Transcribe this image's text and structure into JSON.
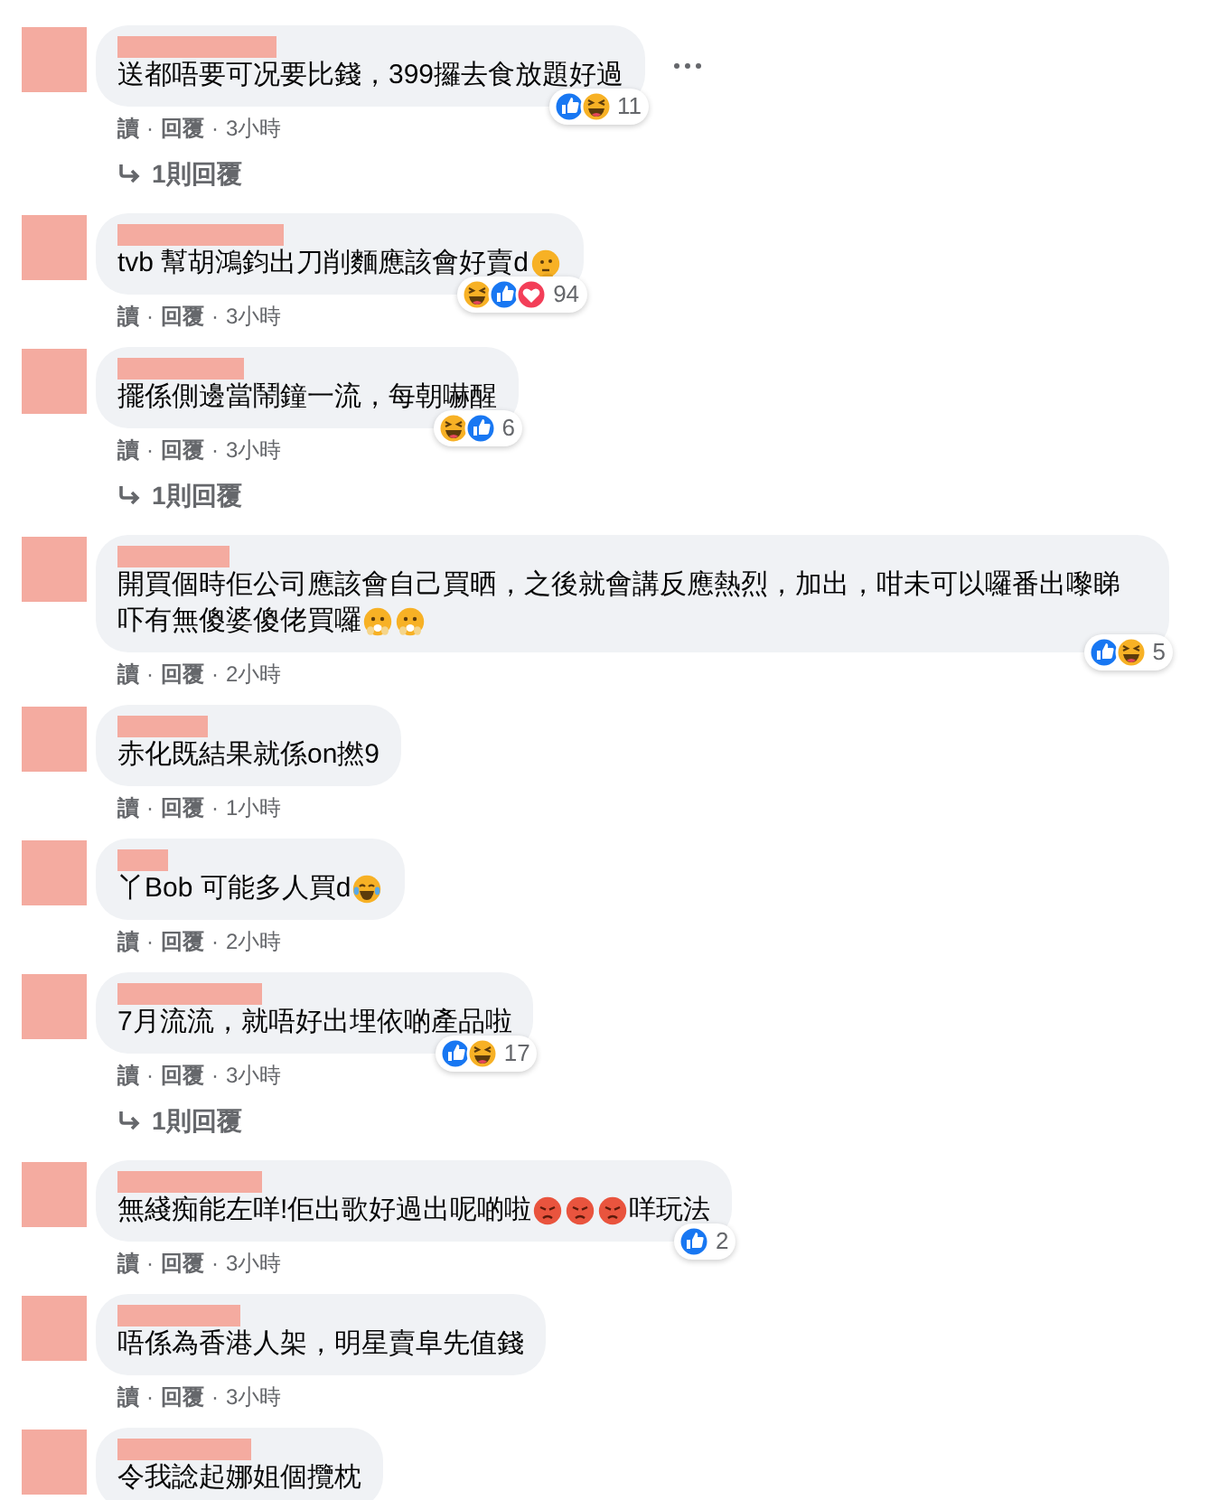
{
  "comments": [
    {
      "parts": [
        {
          "kind": "text",
          "text": "送都唔要可况要比錢，399攞去食放題好過"
        }
      ],
      "reactions": {
        "icons": [
          {
            "kind": "like"
          },
          {
            "kind": "haha"
          }
        ],
        "count": "11"
      },
      "meta": [
        {
          "kind": "link",
          "text": "讀"
        },
        {
          "kind": "sep",
          "text": "·"
        },
        {
          "kind": "link",
          "text": "回覆"
        },
        {
          "kind": "sep",
          "text": "·"
        },
        {
          "kind": "time",
          "text": "3小時"
        }
      ],
      "replies": "1則回覆",
      "more": true
    },
    {
      "parts": [
        {
          "kind": "text",
          "text": "tvb 幫胡鴻鈞出刀削麵應該會好賣d"
        },
        {
          "kind": "thinking"
        }
      ],
      "reactions": {
        "icons": [
          {
            "kind": "haha"
          },
          {
            "kind": "like"
          },
          {
            "kind": "love"
          }
        ],
        "count": "94"
      },
      "meta": [
        {
          "kind": "link",
          "text": "讀"
        },
        {
          "kind": "sep",
          "text": "·"
        },
        {
          "kind": "link",
          "text": "回覆"
        },
        {
          "kind": "sep",
          "text": "·"
        },
        {
          "kind": "time",
          "text": "3小時"
        }
      ],
      "more": false
    },
    {
      "parts": [
        {
          "kind": "text",
          "text": "擺係側邊當鬧鐘一流，每朝嚇醒"
        }
      ],
      "reactions": {
        "icons": [
          {
            "kind": "haha"
          },
          {
            "kind": "like"
          }
        ],
        "count": "6"
      },
      "meta": [
        {
          "kind": "link",
          "text": "讀"
        },
        {
          "kind": "sep",
          "text": "·"
        },
        {
          "kind": "link",
          "text": "回覆"
        },
        {
          "kind": "sep",
          "text": "·"
        },
        {
          "kind": "time",
          "text": "3小時"
        }
      ],
      "replies": "1則回覆",
      "more": false
    },
    {
      "parts": [
        {
          "kind": "text",
          "text": "開買個時佢公司應該會自己買晒，之後就會講反應熱烈，加出，咁未可以囉番出嚟睇"
        },
        {
          "kind": "break"
        },
        {
          "kind": "text",
          "text": "吓有無傻婆傻佬買囉"
        },
        {
          "kind": "shocked"
        },
        {
          "kind": "shocked"
        }
      ],
      "reactions": {
        "icons": [
          {
            "kind": "like"
          },
          {
            "kind": "haha"
          }
        ],
        "count": "5"
      },
      "meta": [
        {
          "kind": "link",
          "text": "讀"
        },
        {
          "kind": "sep",
          "text": "·"
        },
        {
          "kind": "link",
          "text": "回覆"
        },
        {
          "kind": "sep",
          "text": "·"
        },
        {
          "kind": "time",
          "text": "2小時"
        }
      ],
      "more": false
    },
    {
      "parts": [
        {
          "kind": "text",
          "text": "赤化既結果就係on撚9"
        }
      ],
      "meta": [
        {
          "kind": "link",
          "text": "讀"
        },
        {
          "kind": "sep",
          "text": "·"
        },
        {
          "kind": "link",
          "text": "回覆"
        },
        {
          "kind": "sep",
          "text": "·"
        },
        {
          "kind": "time",
          "text": "1小時"
        }
      ],
      "more": false
    },
    {
      "parts": [
        {
          "kind": "text",
          "text": "丫Bob 可能多人買d"
        },
        {
          "kind": "tears"
        }
      ],
      "meta": [
        {
          "kind": "link",
          "text": "讀"
        },
        {
          "kind": "sep",
          "text": "·"
        },
        {
          "kind": "link",
          "text": "回覆"
        },
        {
          "kind": "sep",
          "text": "·"
        },
        {
          "kind": "time",
          "text": "2小時"
        }
      ],
      "more": false
    },
    {
      "parts": [
        {
          "kind": "text",
          "text": "7月流流，就唔好出埋依啲產品啦"
        }
      ],
      "reactions": {
        "icons": [
          {
            "kind": "like"
          },
          {
            "kind": "haha"
          }
        ],
        "count": "17"
      },
      "meta": [
        {
          "kind": "link",
          "text": "讀"
        },
        {
          "kind": "sep",
          "text": "·"
        },
        {
          "kind": "link",
          "text": "回覆"
        },
        {
          "kind": "sep",
          "text": "·"
        },
        {
          "kind": "time",
          "text": "3小時"
        }
      ],
      "replies": "1則回覆",
      "more": false
    },
    {
      "parts": [
        {
          "kind": "text",
          "text": "無綫痴能左咩!佢出歌好過出呢啲啦"
        },
        {
          "kind": "angry"
        },
        {
          "kind": "angry"
        },
        {
          "kind": "angry"
        },
        {
          "kind": "text",
          "text": "咩玩法"
        }
      ],
      "reactions": {
        "icons": [
          {
            "kind": "like"
          }
        ],
        "count": "2"
      },
      "meta": [
        {
          "kind": "link",
          "text": "讀"
        },
        {
          "kind": "sep",
          "text": "·"
        },
        {
          "kind": "link",
          "text": "回覆"
        },
        {
          "kind": "sep",
          "text": "·"
        },
        {
          "kind": "time",
          "text": "3小時"
        }
      ],
      "more": false
    },
    {
      "parts": [
        {
          "kind": "text",
          "text": "唔係為香港人架，明星賣阜先值錢"
        }
      ],
      "meta": [
        {
          "kind": "link",
          "text": "讀"
        },
        {
          "kind": "sep",
          "text": "·"
        },
        {
          "kind": "link",
          "text": "回覆"
        },
        {
          "kind": "sep",
          "text": "·"
        },
        {
          "kind": "time",
          "text": "3小時"
        }
      ],
      "more": false
    },
    {
      "parts": [
        {
          "kind": "text",
          "text": "令我諗起娜姐個攬枕"
        }
      ],
      "more": false
    }
  ]
}
